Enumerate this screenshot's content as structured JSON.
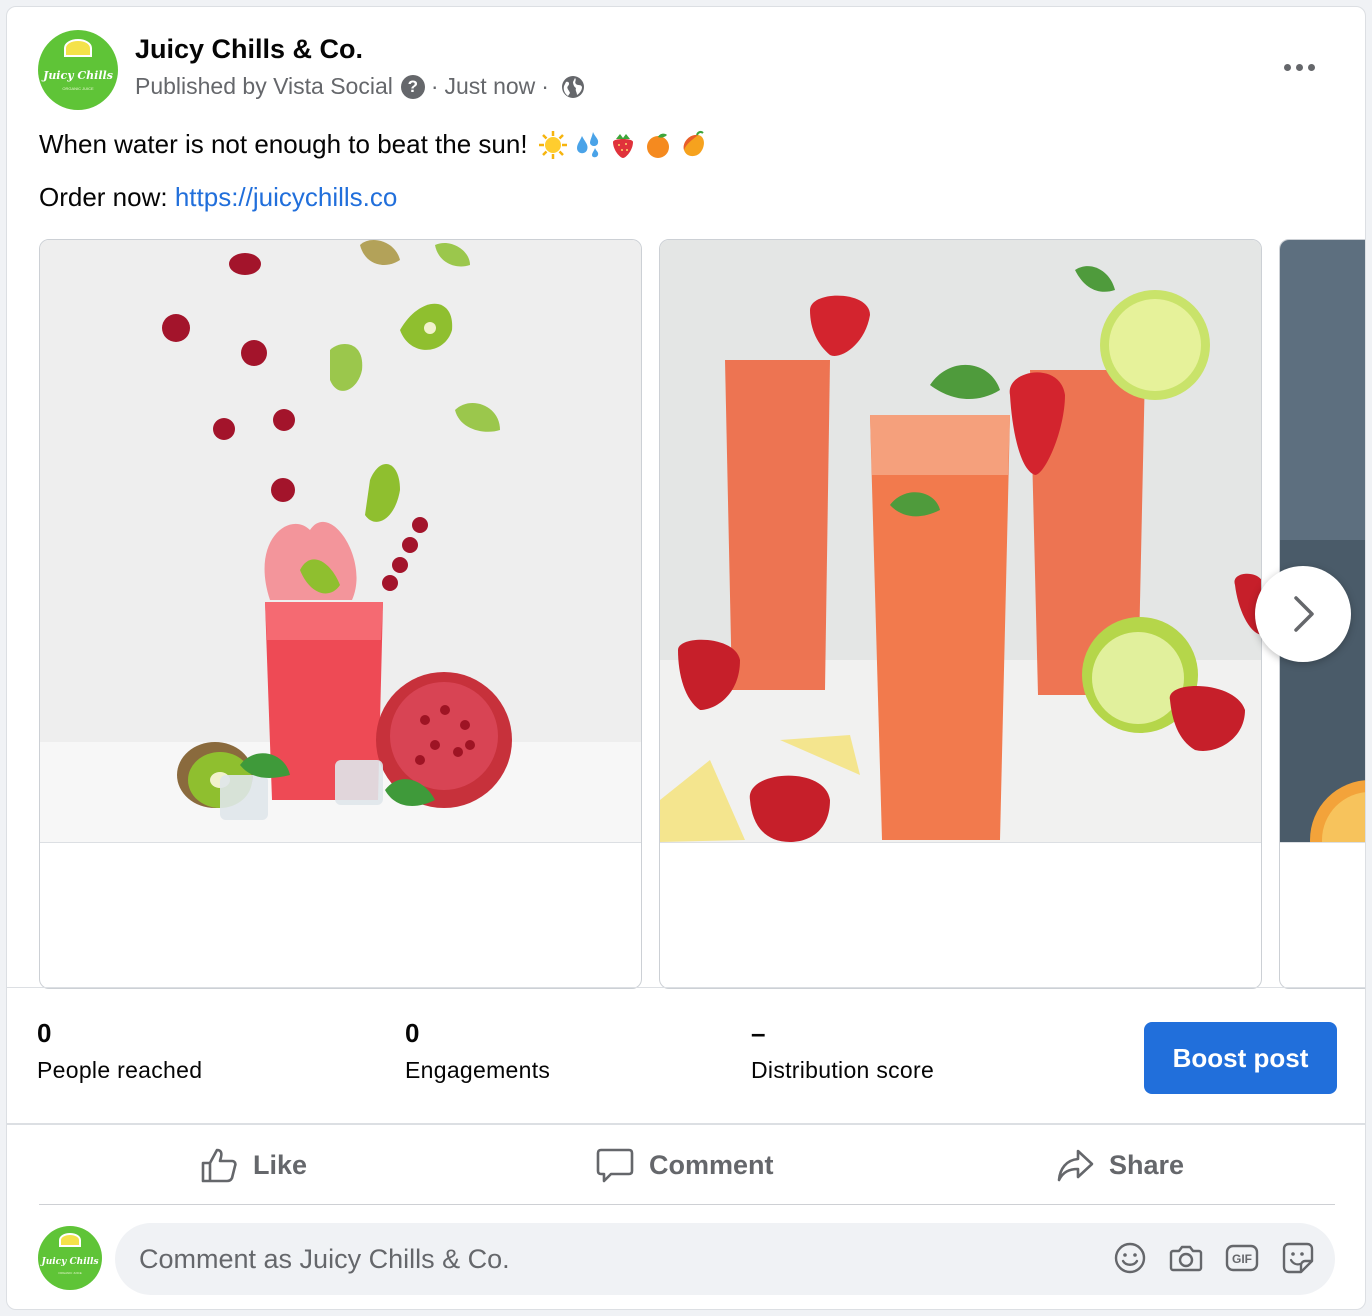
{
  "post": {
    "page_name": "Juicy Chills & Co.",
    "published_by": "Published by Vista Social",
    "separator": "·",
    "time": "Just now",
    "help_icon": "question-circle-icon",
    "audience_icon": "globe-icon",
    "avatar_text": "Juicy Chills",
    "avatar_subtext": "ORGANIC JUICE",
    "line1": "When water is not enough to beat the sun!",
    "emojis": [
      "sun",
      "sweat-droplets",
      "strawberry",
      "tangerine",
      "mango"
    ],
    "line2_prefix": "Order now:",
    "link": "https://juicychills.co"
  },
  "carousel": {
    "items": [
      {
        "image": "red juice glass with kiwi, cranberries and pomegranate"
      },
      {
        "image": "strawberry lime iced drinks"
      },
      {
        "image": "partial citrus image"
      }
    ],
    "next_icon": "chevron-right-icon"
  },
  "insights": {
    "people_reached_value": "0",
    "people_reached_label": "People reached",
    "engagements_value": "0",
    "engagements_label": "Engagements",
    "distribution_value": "–",
    "distribution_label": "Distribution score",
    "boost_label": "Boost post"
  },
  "actions": {
    "like": "Like",
    "comment": "Comment",
    "share": "Share"
  },
  "comment_box": {
    "placeholder": "Comment as Juicy Chills & Co.",
    "icons": [
      "emoji-icon",
      "camera-icon",
      "gif-icon",
      "sticker-icon"
    ]
  },
  "colors": {
    "accent": "#216fdb",
    "brand_green": "#5fc437",
    "muted": "#65676b"
  }
}
